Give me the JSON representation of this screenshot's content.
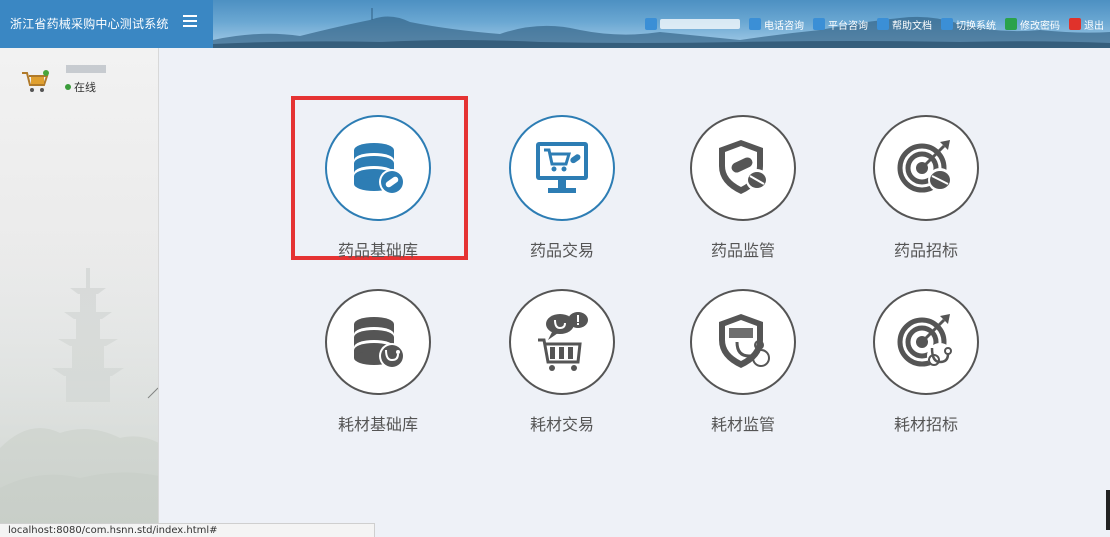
{
  "header": {
    "title": "浙江省药械采购中心测试系统",
    "links": [
      {
        "label": "电话咨询",
        "icon": "phone-icon",
        "color": "#3b8fd6"
      },
      {
        "label": "平台咨询",
        "icon": "chat-icon",
        "color": "#3b8fd6"
      },
      {
        "label": "帮助文档",
        "icon": "help-icon",
        "color": "#3b8fd6"
      },
      {
        "label": "切换系统",
        "icon": "switch-icon",
        "color": "#3b8fd6"
      },
      {
        "label": "修改密码",
        "icon": "lock-icon",
        "color": "#2aa24a"
      },
      {
        "label": "退出",
        "icon": "logout-icon",
        "color": "#e0322b"
      }
    ]
  },
  "sidebar": {
    "status": "在线"
  },
  "modules": [
    {
      "label": "药品基础库",
      "icon": "database-pill-icon",
      "active": true
    },
    {
      "label": "药品交易",
      "icon": "cart-monitor-icon",
      "active": true
    },
    {
      "label": "药品监管",
      "icon": "shield-pill-icon",
      "active": false
    },
    {
      "label": "药品招标",
      "icon": "target-pill-icon",
      "active": false
    },
    {
      "label": "耗材基础库",
      "icon": "database-stethoscope-icon",
      "active": false
    },
    {
      "label": "耗材交易",
      "icon": "cart-chat-icon",
      "active": false
    },
    {
      "label": "耗材监管",
      "icon": "shield-stethoscope-icon",
      "active": false
    },
    {
      "label": "耗材招标",
      "icon": "target-stethoscope-icon",
      "active": false
    }
  ],
  "statusbar": {
    "url": "localhost:8080/com.hsnn.std/index.html#"
  },
  "colors": {
    "accent": "#2d7db4",
    "highlight": "#e53333",
    "icon_gray": "#555555"
  }
}
